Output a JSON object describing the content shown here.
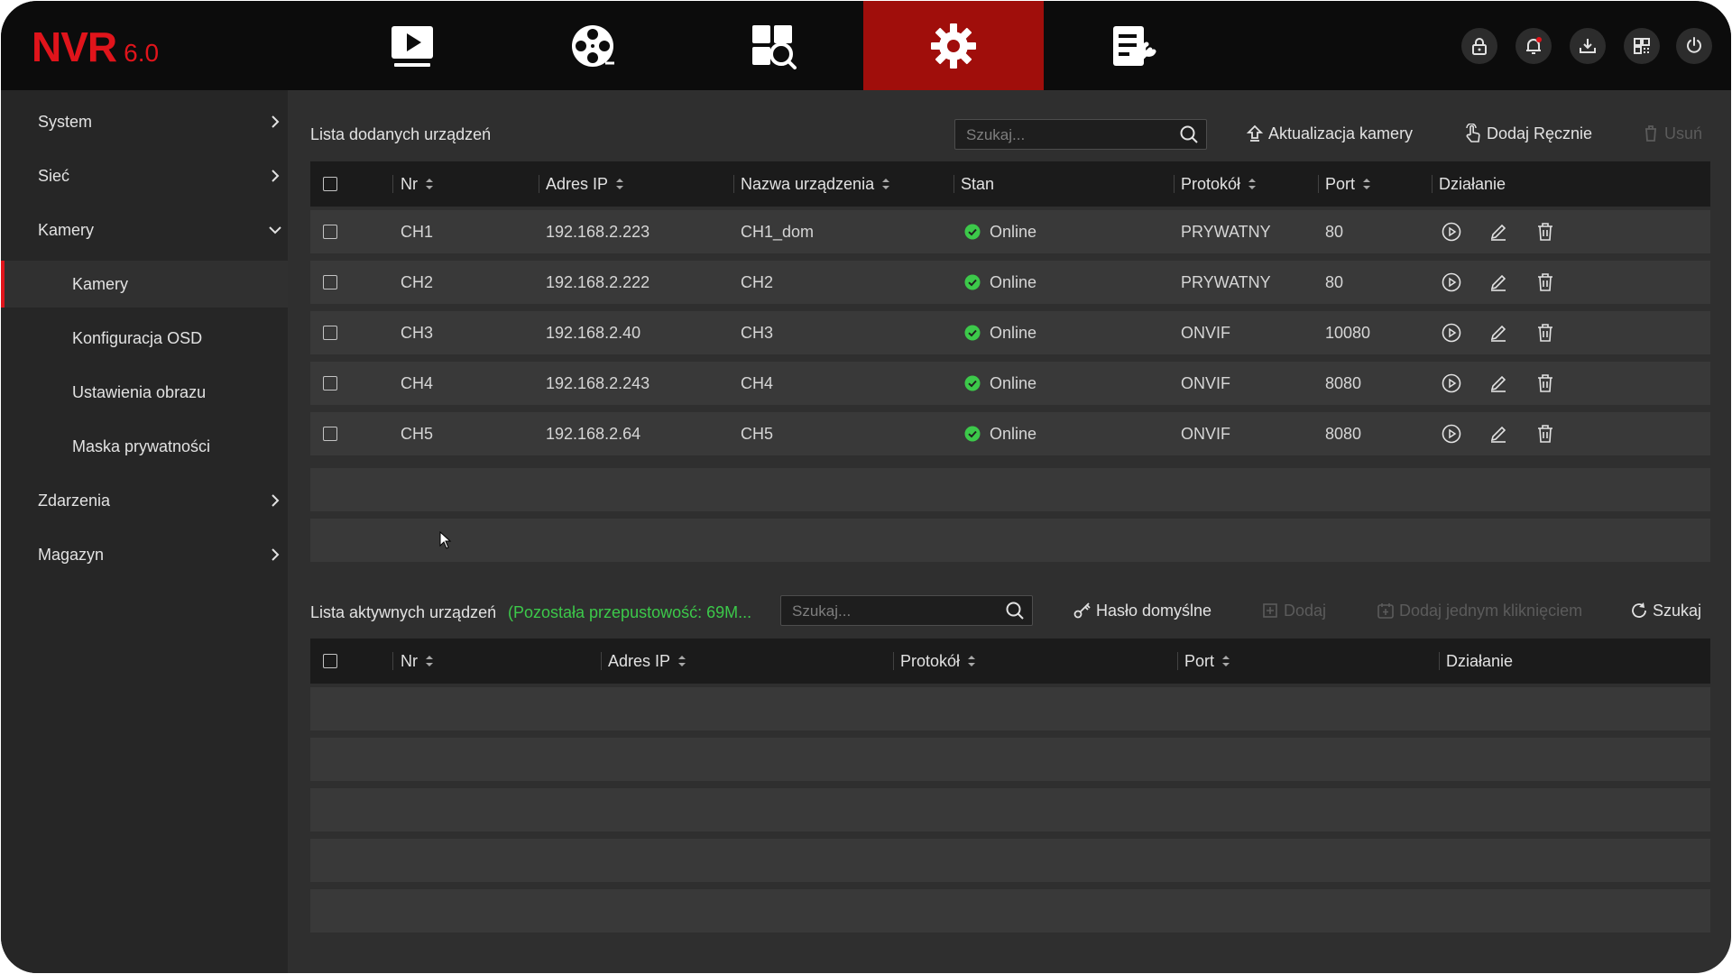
{
  "logo": {
    "main": "NVR",
    "version": "6.0"
  },
  "nav_tabs": [
    {
      "name": "playback-tab",
      "icon": "play-monitor-icon"
    },
    {
      "name": "film-reel-tab",
      "icon": "film-reel-icon"
    },
    {
      "name": "smart-search-tab",
      "icon": "search-grid-icon"
    },
    {
      "name": "settings-tab",
      "icon": "gear-icon",
      "active": true
    },
    {
      "name": "maintenance-tab",
      "icon": "document-wrench-icon"
    }
  ],
  "system_buttons": [
    "lock-icon",
    "bell-icon",
    "download-icon",
    "qr-grid-icon",
    "power-icon"
  ],
  "sidebar": {
    "items": [
      {
        "label": "System"
      },
      {
        "label": "Sieć"
      },
      {
        "label": "Kamery"
      },
      {
        "label": "Kamery"
      },
      {
        "label": "Konfiguracja OSD"
      },
      {
        "label": "Ustawienia obrazu"
      },
      {
        "label": "Maska prywatności"
      },
      {
        "label": "Zdarzenia"
      },
      {
        "label": "Magazyn"
      }
    ]
  },
  "added_devices": {
    "title": "Lista dodanych urządzeń",
    "search_placeholder": "Szukaj...",
    "buttons": {
      "update": "Aktualizacja kamery",
      "add_manual": "Dodaj Ręcznie",
      "delete": "Usuń"
    },
    "columns": [
      "Nr",
      "Adres IP",
      "Nazwa urządzenia",
      "Stan",
      "Protokół",
      "Port",
      "Działanie"
    ],
    "rows": [
      {
        "nr": "CH1",
        "ip": "192.168.2.223",
        "name": "CH1_dom",
        "status": "Online",
        "protocol": "PRYWATNY",
        "port": "80"
      },
      {
        "nr": "CH2",
        "ip": "192.168.2.222",
        "name": "CH2",
        "status": "Online",
        "protocol": "PRYWATNY",
        "port": "80"
      },
      {
        "nr": "CH3",
        "ip": "192.168.2.40",
        "name": "CH3",
        "status": "Online",
        "protocol": "ONVIF",
        "port": "10080"
      },
      {
        "nr": "CH4",
        "ip": "192.168.2.243",
        "name": "CH4",
        "status": "Online",
        "protocol": "ONVIF",
        "port": "8080"
      },
      {
        "nr": "CH5",
        "ip": "192.168.2.64",
        "name": "CH5",
        "status": "Online",
        "protocol": "ONVIF",
        "port": "8080"
      }
    ]
  },
  "active_devices": {
    "title": "Lista aktywnych urządzeń",
    "bandwidth_note": "(Pozostała przepustowość: 69M...",
    "search_placeholder": "Szukaj...",
    "buttons": {
      "default_password": "Hasło domyślne",
      "add": "Dodaj",
      "add_one_click": "Dodaj jednym kliknięciem",
      "search": "Szukaj"
    },
    "columns": [
      "Nr",
      "Adres IP",
      "Protokół",
      "Port",
      "Działanie"
    ]
  },
  "colors": {
    "accent_red": "#a00e0b",
    "logo_red": "#e0141b",
    "online_green": "#3cc94a"
  }
}
